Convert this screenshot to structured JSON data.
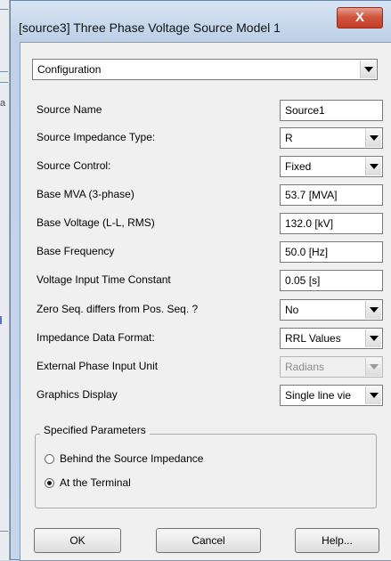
{
  "window": {
    "title": "[source3] Three Phase Voltage Source Model 1",
    "close_symbol": "X"
  },
  "background": {
    "edge_char": "a"
  },
  "category": {
    "value": "Configuration"
  },
  "fields": [
    {
      "label": "Source Name",
      "control": "text",
      "value": "Source1"
    },
    {
      "label": "Source Impedance Type:",
      "control": "select",
      "value": "R"
    },
    {
      "label": "Source Control:",
      "control": "select",
      "value": "Fixed"
    },
    {
      "label": "Base MVA (3-phase)",
      "control": "text",
      "value": "53.7 [MVA]"
    },
    {
      "label": "Base Voltage (L-L, RMS)",
      "control": "text",
      "value": "132.0 [kV]"
    },
    {
      "label": "Base Frequency",
      "control": "text",
      "value": "50.0 [Hz]"
    },
    {
      "label": "Voltage Input Time Constant",
      "control": "text",
      "value": "0.05 [s]"
    },
    {
      "label": "Zero Seq. differs from Pos. Seq. ?",
      "control": "select",
      "value": "No"
    },
    {
      "label": "Impedance Data Format:",
      "control": "select",
      "value": "RRL Values"
    },
    {
      "label": "External Phase Input Unit",
      "control": "select",
      "value": "Radians",
      "disabled": true
    },
    {
      "label": "Graphics Display",
      "control": "select",
      "value": "Single line vie"
    }
  ],
  "specified": {
    "title": "Specified Parameters",
    "options": [
      {
        "label": "Behind the Source Impedance",
        "checked": false
      },
      {
        "label": "At the Terminal",
        "checked": true
      }
    ]
  },
  "buttons": {
    "ok": "OK",
    "cancel": "Cancel",
    "help": "Help..."
  },
  "icons": {
    "dropdown": "chevron-down-icon",
    "close": "close-icon"
  }
}
